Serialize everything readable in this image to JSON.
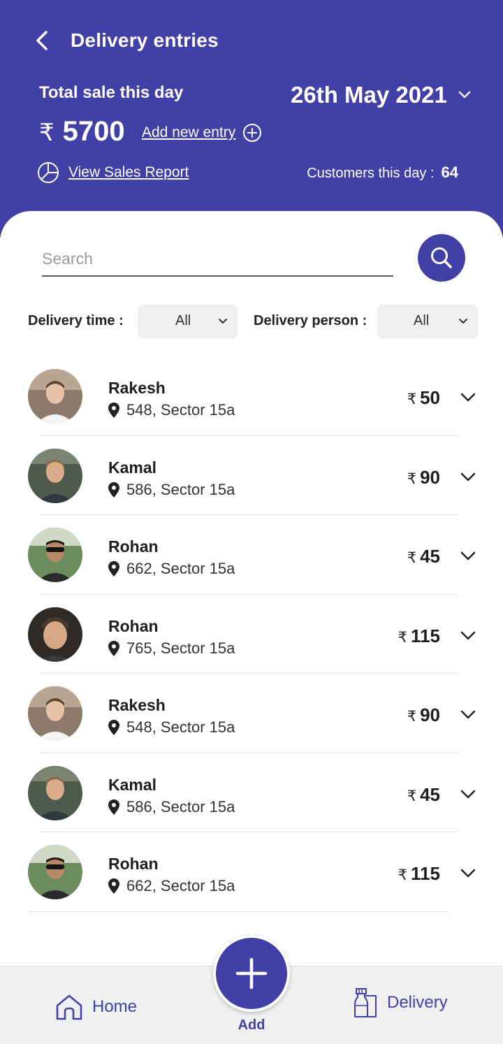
{
  "header": {
    "title": "Delivery entries",
    "sale_label": "Total sale this day",
    "date": "26th May 2021",
    "currency_symbol": "₹",
    "total": "5700",
    "add_entry": "Add new entry",
    "report_link": "View Sales Report",
    "customers_label": "Customers this day :",
    "customers_count": "64"
  },
  "search": {
    "placeholder": "Search"
  },
  "filters": {
    "delivery_time_label": "Delivery time :",
    "delivery_time_value": "All",
    "delivery_person_label": "Delivery person :",
    "delivery_person_value": "All"
  },
  "entries": [
    {
      "name": "Rakesh",
      "address": "548, Sector 15a",
      "amount": "50"
    },
    {
      "name": "Kamal",
      "address": "586, Sector 15a",
      "amount": "90"
    },
    {
      "name": "Rohan",
      "address": "662, Sector 15a",
      "amount": "45"
    },
    {
      "name": "Rohan",
      "address": "765, Sector 15a",
      "amount": "115"
    },
    {
      "name": "Rakesh",
      "address": "548, Sector 15a",
      "amount": "90"
    },
    {
      "name": "Kamal",
      "address": "586, Sector 15a",
      "amount": "45"
    },
    {
      "name": "Rohan",
      "address": "662, Sector 15a",
      "amount": "115"
    }
  ],
  "nav": {
    "home": "Home",
    "add": "Add",
    "delivery": "Delivery"
  },
  "colors": {
    "brand": "#4040a6",
    "nav_bg": "#f0f0f0",
    "filter_bg": "#efefef"
  }
}
